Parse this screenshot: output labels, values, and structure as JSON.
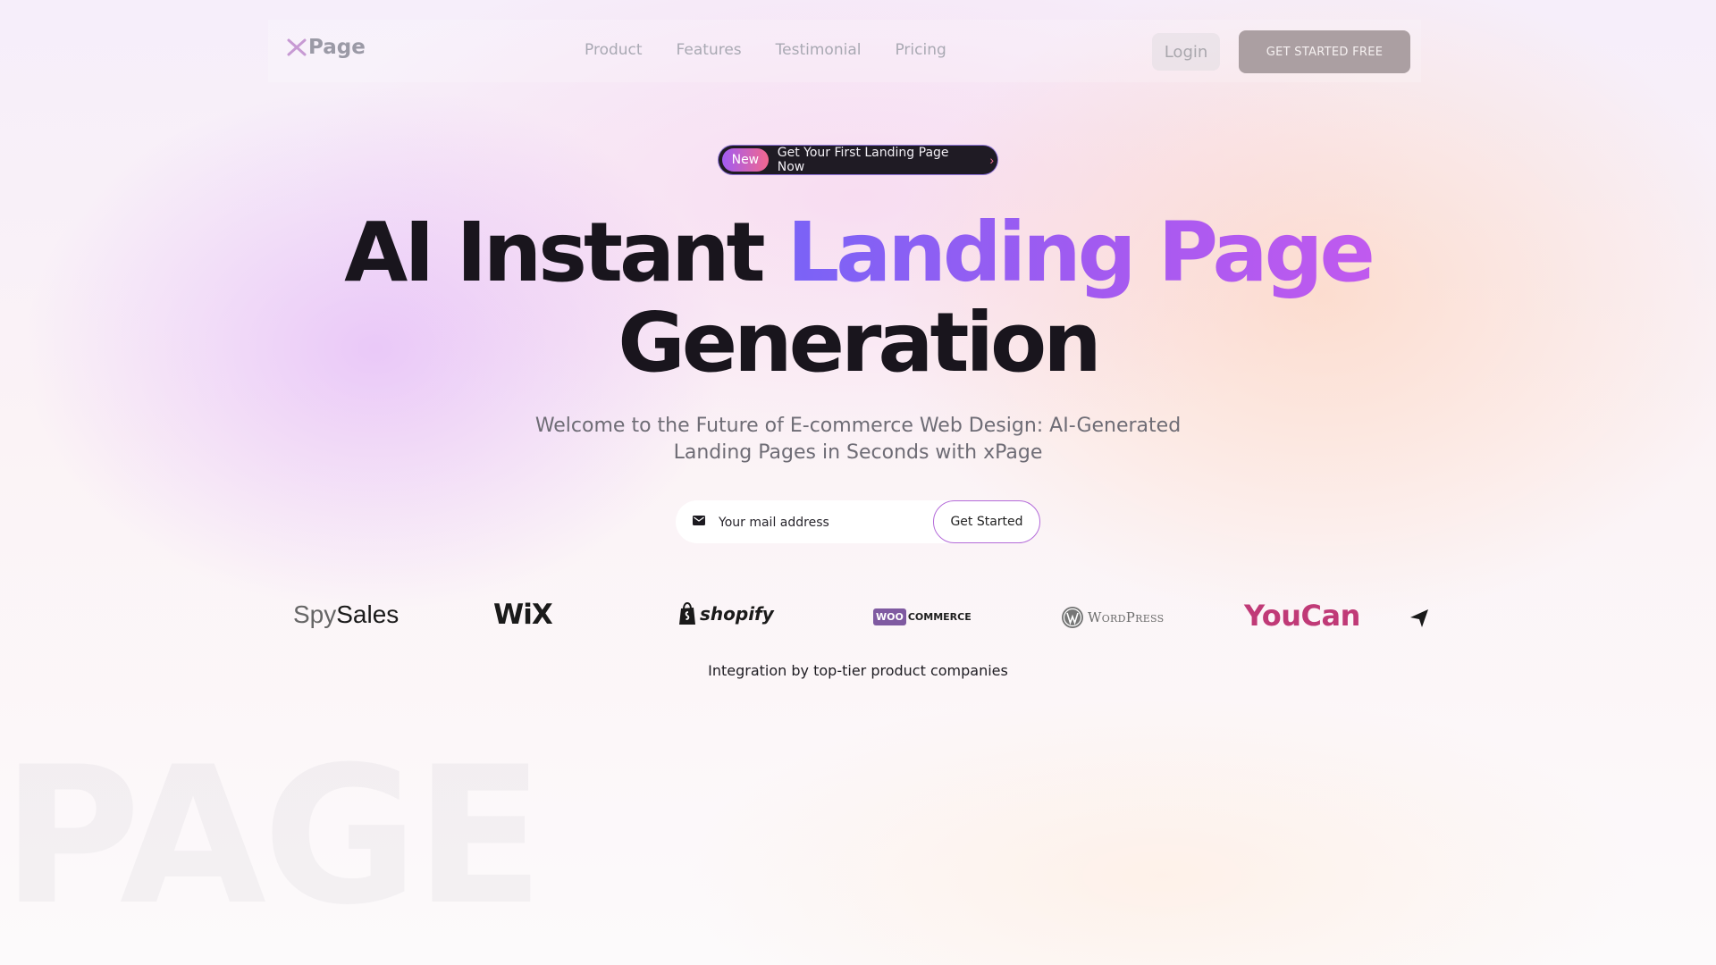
{
  "nav": {
    "logo": "Page",
    "links": [
      "Product",
      "Features",
      "Testimonial",
      "Pricing"
    ],
    "login_label": "Login",
    "cta_label": "GET STARTED FREE"
  },
  "badge": {
    "tag": "New",
    "text": "Get Your First Landing Page Now",
    "chevron": "›"
  },
  "hero": {
    "title_part1": "AI Instant ",
    "title_highlight": "Landing Page",
    "title_part2": "Generation",
    "subtitle": "Welcome to the Future of E-commerce Web Design: AI-Generated Landing Pages in Seconds with xPage"
  },
  "signup": {
    "icon": "mail-icon",
    "placeholder": "Your mail address",
    "button_label": "Get Started"
  },
  "partners": {
    "spysales_light": "Spy",
    "spysales_bold": "Sales",
    "wix": "WiX",
    "shopify": "shopify",
    "woo_box": "WOO",
    "woo_rest": "COMMERCE",
    "wordpress": "WordPress",
    "youcan": "YouCan",
    "caption": "Integration by top-tier product companies"
  },
  "watermark": "PAGE",
  "colors": {
    "accent_start": "#7a63f6",
    "accent_end": "#c05aef",
    "dark": "#19151d",
    "youcan": "#c03a77",
    "woo": "#7f5aa1"
  }
}
